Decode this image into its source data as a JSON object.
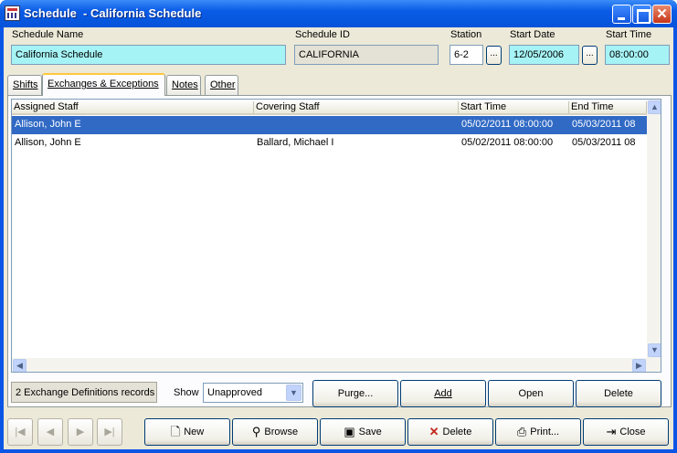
{
  "window": {
    "title": "Schedule  - California Schedule"
  },
  "header": {
    "schedule_name_label": "Schedule Name",
    "schedule_name_value": "California Schedule",
    "schedule_id_label": "Schedule ID",
    "schedule_id_value": "CALIFORNIA",
    "station_label": "Station",
    "station_value": "6-2",
    "start_date_label": "Start Date",
    "start_date_value": "12/05/2006",
    "start_time_label": "Start Time",
    "start_time_value": "08:00:00",
    "lookup_button": "..."
  },
  "tabs": [
    {
      "label": "Shifts"
    },
    {
      "label": "Exchanges & Exceptions"
    },
    {
      "label": "Notes"
    },
    {
      "label": "Other"
    }
  ],
  "grid": {
    "columns": [
      "Assigned Staff",
      "Covering Staff",
      "Start Time",
      "End Time"
    ],
    "rows": [
      {
        "assigned": "Allison, John E",
        "covering": "",
        "start": "05/02/2011 08:00:00",
        "end": "05/03/2011 08",
        "selected": true
      },
      {
        "assigned": "Allison, John E",
        "covering": "Ballard, Michael I",
        "start": "05/02/2011 08:00:00",
        "end": "05/03/2011 08",
        "selected": false
      }
    ]
  },
  "footer": {
    "record_count": "2 Exchange Definitions records",
    "show_label": "Show",
    "show_value": "Unapproved",
    "purge_button": "Purge...",
    "add_button": "Add",
    "open_button": "Open",
    "delete_button": "Delete"
  },
  "toolbar": {
    "new": "New",
    "browse": "Browse",
    "save": "Save",
    "delete": "Delete",
    "print": "Print...",
    "close": "Close"
  },
  "colors": {
    "accent": "#316ac5",
    "highlight_field": "#a6f3f5",
    "titlebar": "#0a5be6"
  }
}
